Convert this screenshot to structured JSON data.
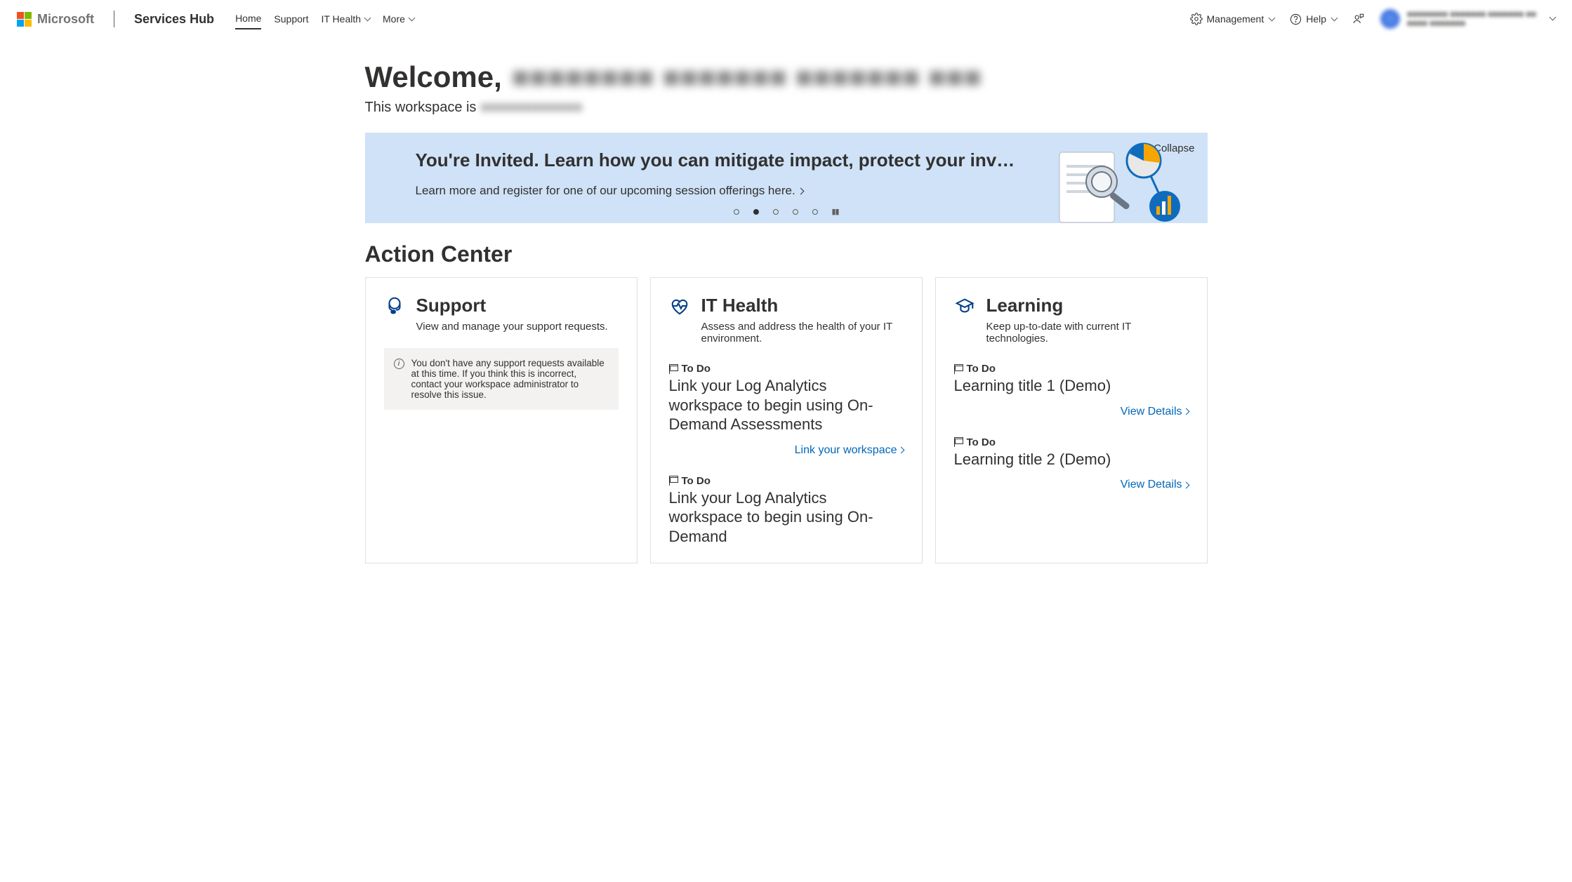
{
  "header": {
    "brand": "Microsoft",
    "product": "Services Hub",
    "nav": {
      "home": "Home",
      "support": "Support",
      "it_health": "IT Health",
      "more": "More"
    },
    "management": "Management",
    "help": "Help",
    "user": {
      "line1": "■■■■■■■■ ■■■■■■■ ■■■■■■■ ■■",
      "line2": "■■■■ ■■■■■■■"
    }
  },
  "welcome": {
    "label": "Welcome,",
    "name": "■■■■■■■■ ■■■■■■■ ■■■■■■■ ■■■",
    "workspace_prefix": "This workspace is",
    "workspace_name": "■■■■■■■■■■■■"
  },
  "banner": {
    "title": "You're Invited. Learn how you can mitigate impact, protect your inv…",
    "link": "Learn more and register for one of our upcoming session offerings here.",
    "collapse": "Collapse"
  },
  "action_center": {
    "title": "Action Center",
    "support": {
      "title": "Support",
      "sub": "View and manage your support requests.",
      "info": "You don't have any support requests available at this time. If you think this is incorrect, contact your workspace administrator to resolve this issue."
    },
    "it_health": {
      "title": "IT Health",
      "sub": "Assess and address the health of your IT environment.",
      "todo_label": "To Do",
      "items": [
        {
          "title": "Link your Log Analytics workspace to begin using On-Demand Assessments",
          "action": "Link your workspace"
        },
        {
          "title": "Link your Log Analytics workspace to begin using On-Demand",
          "action": ""
        }
      ]
    },
    "learning": {
      "title": "Learning",
      "sub": "Keep up-to-date with current IT technologies.",
      "todo_label": "To Do",
      "items": [
        {
          "title": "Learning title 1 (Demo)",
          "action": "View Details"
        },
        {
          "title": "Learning title 2 (Demo)",
          "action": "View Details"
        }
      ]
    }
  }
}
